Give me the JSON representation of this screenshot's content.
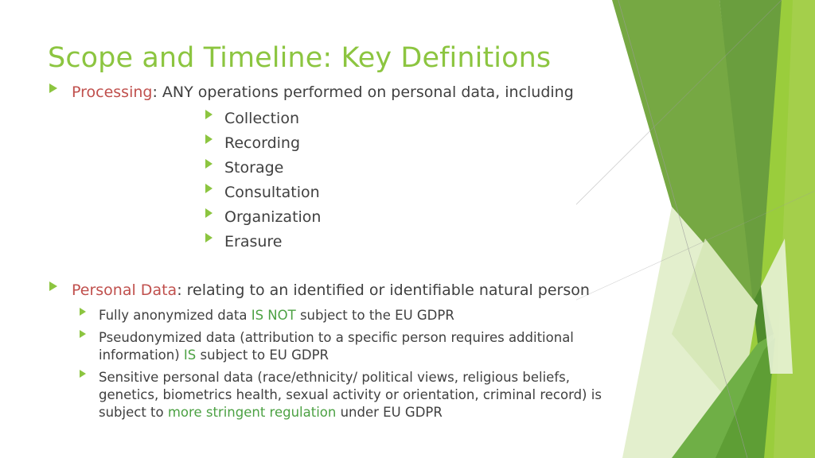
{
  "slide": {
    "title": "Scope and Timeline: Key Definitions",
    "background_color": "#FFFFFF",
    "title_color": "#8CC540",
    "accent_green": "#8CC540",
    "highlight_red": "#C0504D",
    "highlight_green": "#4CA143",
    "body_color": "#404040"
  },
  "content": {
    "processing": {
      "term": "Processing",
      "definition": ": ANY operations performed on personal data, including",
      "items": [
        {
          "label": "Collection"
        },
        {
          "label": "Recording"
        },
        {
          "label": "Storage"
        },
        {
          "label": "Consultation"
        },
        {
          "label": "Organization"
        },
        {
          "label": "Erasure"
        }
      ]
    },
    "personal_data": {
      "term": "Personal Data",
      "definition": ": relating to an identified or identifiable natural person",
      "items": [
        {
          "part1": "Fully anonymized data ",
          "highlight": "IS NOT",
          "highlight_color": "green",
          "part2": " subject to the EU GDPR"
        },
        {
          "part1": "Pseudonymized data (attribution to a specific person requires additional information) ",
          "highlight": "IS",
          "highlight_color": "green",
          "part2": " subject to EU GDPR"
        },
        {
          "part1": "Sensitive personal data (race/ethnicity/ political views, religious beliefs, genetics, biometrics health, sexual activity or orientation, criminal record) is subject to ",
          "highlight": "more stringent regulation",
          "highlight_color": "green",
          "part2": " under EU GDPR"
        }
      ]
    }
  },
  "decoration": {
    "name": "facet-theme-graphic",
    "palette": [
      "#76A843",
      "#6A9E3E",
      "#8CC540",
      "#9ACD3C",
      "#A4CF4B",
      "#D7E8B9",
      "#E3EFCD",
      "#C7E09A",
      "#6FAF46",
      "#5E9E35"
    ]
  }
}
